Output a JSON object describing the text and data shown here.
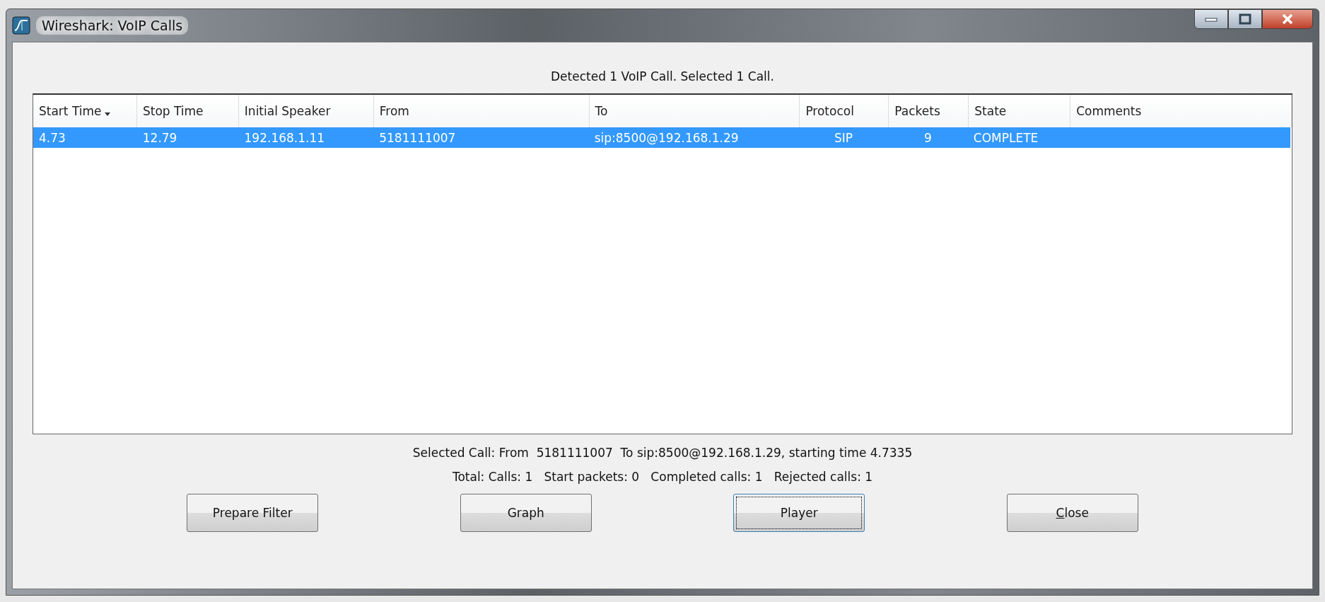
{
  "window": {
    "title": "Wireshark: VoIP Calls"
  },
  "summary": "Detected 1 VoIP Call. Selected 1 Call.",
  "table": {
    "columns": [
      {
        "label": "Start Time",
        "sorted": true
      },
      {
        "label": "Stop Time",
        "sorted": false
      },
      {
        "label": "Initial Speaker",
        "sorted": false
      },
      {
        "label": "From",
        "sorted": false
      },
      {
        "label": "To",
        "sorted": false
      },
      {
        "label": "Protocol",
        "sorted": false
      },
      {
        "label": "Packets",
        "sorted": false
      },
      {
        "label": "State",
        "sorted": false
      },
      {
        "label": "Comments",
        "sorted": false
      }
    ],
    "rows": [
      {
        "selected": true,
        "cells": [
          "4.73",
          "12.79",
          "192.168.1.11",
          "5181111007",
          "sip:8500@192.168.1.29",
          "SIP",
          "9",
          "COMPLETE",
          ""
        ]
      }
    ]
  },
  "selected_call": "Selected Call: From  5181111007  To sip:8500@192.168.1.29, starting time 4.7335",
  "totals": "Total: Calls: 1   Start packets: 0   Completed calls: 1   Rejected calls: 1",
  "buttons": [
    {
      "label": "Prepare Filter",
      "focused": false,
      "mnemonic": false
    },
    {
      "label": "Graph",
      "focused": false,
      "mnemonic": false
    },
    {
      "label": "Player",
      "focused": true,
      "mnemonic": false
    },
    {
      "label": "Close",
      "focused": false,
      "mnemonic": true
    }
  ]
}
